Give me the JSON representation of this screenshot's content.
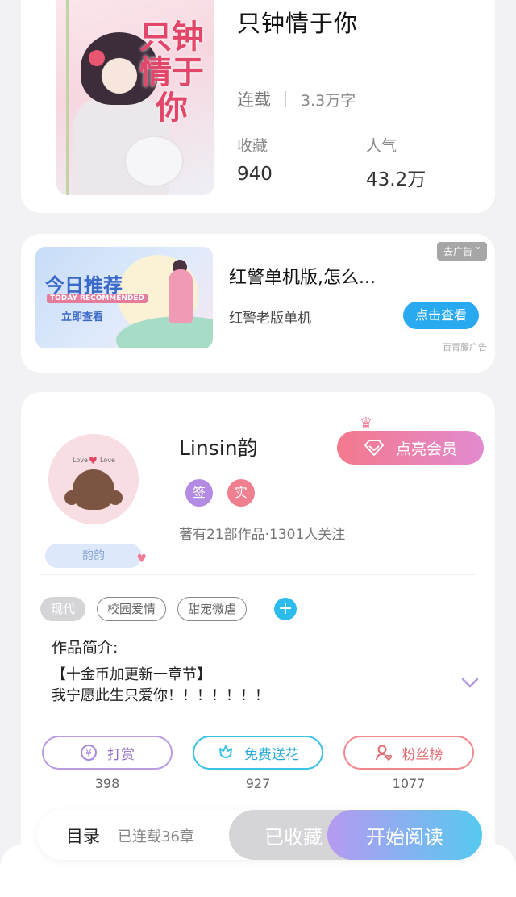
{
  "book": {
    "title": "只钟情于你",
    "cover_text": "只钟情于你",
    "status": "连载",
    "word_count": "3.3万字",
    "favorites_label": "收藏",
    "favorites_value": "940",
    "popularity_label": "人气",
    "popularity_value": "43.2万"
  },
  "ad": {
    "banner_title": "今日推荐",
    "banner_subtitle": "TODAY RECOMMENDED",
    "banner_cta": "立即查看",
    "title": "红警单机版,怎么...",
    "description": "红警老版单机",
    "close_label": "去广告 ˅",
    "button_label": "点击查看",
    "source": "百青藤广告"
  },
  "author": {
    "name": "Linsin韵",
    "badge_name": "韵韵",
    "avatar_text_left": "Love",
    "avatar_text_right": "Love",
    "vip_button": "点亮会员",
    "tag_sign": "签",
    "tag_real": "实",
    "meta": "著有21部作品·1301人关注"
  },
  "genres": [
    {
      "label": "现代",
      "active": true
    },
    {
      "label": "校园爱情",
      "active": false
    },
    {
      "label": "甜宠微虐",
      "active": false
    }
  ],
  "intro": {
    "title": "作品简介:",
    "line1": "【十金币加更新一章节】",
    "line2": "我宁愿此生只爱你！！！！！！！"
  },
  "actions": {
    "reward_label": "打赏",
    "reward_count": "398",
    "flower_label": "免费送花",
    "flower_count": "927",
    "fans_label": "粉丝榜",
    "fans_count": "1077"
  },
  "bottom": {
    "toc_label": "目录",
    "toc_status": "已连载36章",
    "collected_label": "已收藏",
    "read_label": "开始阅读"
  },
  "colors": {
    "accent_blue": "#29a9ef",
    "accent_purple": "#b69af0",
    "vip_pink": "#f4798c"
  }
}
